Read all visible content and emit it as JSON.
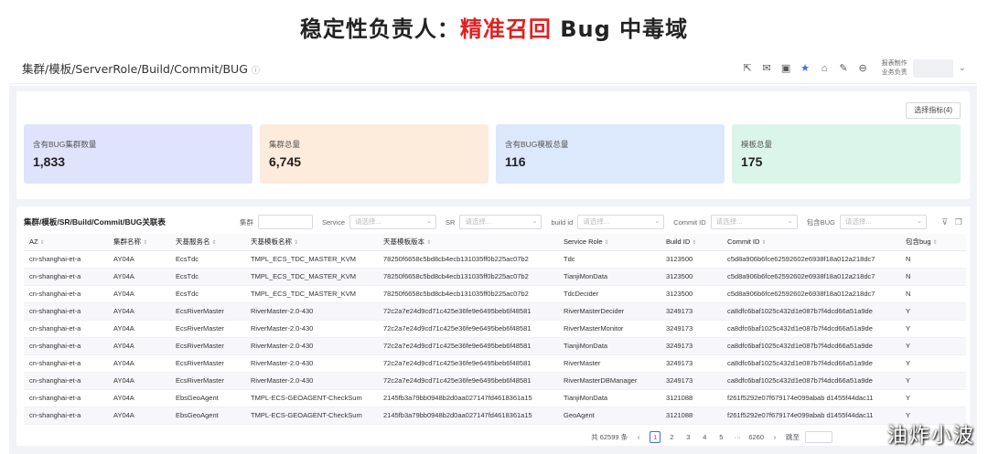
{
  "slide": {
    "title_black_1": "稳定性负责人：",
    "title_red": "精准召回",
    "title_black_2": " Bug 中毒域"
  },
  "header": {
    "breadcrumb": "集群/模板/ServerRole/Build/Commit/BUG",
    "info_icon": "info-icon",
    "icons": [
      "share-icon",
      "mail-icon",
      "image-icon",
      "star-icon",
      "inbox-icon",
      "edit-icon",
      "minus-circle-icon"
    ],
    "owner_line1": "报表制作",
    "owner_line2": "业务负责"
  },
  "stats": {
    "select_button": "选择指标(4)",
    "cards": [
      {
        "label": "含有BUG集群数量",
        "value": "1,833",
        "color": "#dfe3fb"
      },
      {
        "label": "集群总量",
        "value": "6,745",
        "color": "#fdebdc"
      },
      {
        "label": "含有BUG模板总量",
        "value": "116",
        "color": "#dce8fb"
      },
      {
        "label": "模板总量",
        "value": "175",
        "color": "#dcf5ea"
      }
    ]
  },
  "table": {
    "title": "集群/模板/SR/Build/Commit/BUG关联表",
    "filters": [
      {
        "label": "集群",
        "placeholder": ""
      },
      {
        "label": "Service",
        "placeholder": "请选择..."
      },
      {
        "label": "SR",
        "placeholder": "请选择..."
      },
      {
        "label": "build id",
        "placeholder": "请选择..."
      },
      {
        "label": "Commit ID",
        "placeholder": "请选择..."
      },
      {
        "label": "包含BUG",
        "placeholder": "请选择..."
      }
    ],
    "columns": [
      "AZ",
      "集群名称",
      "天基服务名",
      "天基模板名称",
      "天基模板版本",
      "Service Role",
      "Build ID",
      "Commit ID",
      "包含bug"
    ],
    "rows": [
      [
        "cn-shanghai-et-a",
        "AY04A",
        "EcsTdc",
        "TMPL_ECS_TDC_MASTER_KVM",
        "78250f6658c5bd8cb4ecb131035ff0b225ac07b2",
        "Tdc",
        "3123500",
        "c5d8a906b6fce62592602e6938f18a012a218dc7",
        "N"
      ],
      [
        "cn-shanghai-et-a",
        "AY04A",
        "EcsTdc",
        "TMPL_ECS_TDC_MASTER_KVM",
        "78250f6658c5bd8cb4ecb131035ff0b225ac07b2",
        "TianjiMonData",
        "3123500",
        "c5d8a906b6fce62592602e6938f18a012a218dc7",
        "N"
      ],
      [
        "cn-shanghai-et-a",
        "AY04A",
        "EcsTdc",
        "TMPL_ECS_TDC_MASTER_KVM",
        "78250f6658c5bd8cb4ecb131035ff0b225ac07b2",
        "TdcDecider",
        "3123500",
        "c5d8a906b6fce62592602e6938f18a012a218dc7",
        "N"
      ],
      [
        "cn-shanghai-et-a",
        "AY04A",
        "EcsRiverMaster",
        "RiverMaster-2.0-430",
        "72c2a7e24d9cd71c425e36fe9e6495beb6f48581",
        "RiverMasterDecider",
        "3249173",
        "ca8dfc6baf1025c432d1e087b7f4dcd66a51a9de",
        "Y"
      ],
      [
        "cn-shanghai-et-a",
        "AY04A",
        "EcsRiverMaster",
        "RiverMaster-2.0-430",
        "72c2a7e24d9cd71c425e36fe9e6495beb6f48581",
        "RiverMasterMonitor",
        "3249173",
        "ca8dfc6baf1025c432d1e087b7f4dcd66a51a9de",
        "Y"
      ],
      [
        "cn-shanghai-et-a",
        "AY04A",
        "EcsRiverMaster",
        "RiverMaster-2.0-430",
        "72c2a7e24d9cd71c425e36fe9e6495beb6f48581",
        "TianjiMonData",
        "3249173",
        "ca8dfc6baf1025c432d1e087b7f4dcd66a51a9de",
        "Y"
      ],
      [
        "cn-shanghai-et-a",
        "AY04A",
        "EcsRiverMaster",
        "RiverMaster-2.0-430",
        "72c2a7e24d9cd71c425e36fe9e6495beb6f48581",
        "RiverMaster",
        "3249173",
        "ca8dfc6baf1025c432d1e087b7f4dcd66a51a9de",
        "Y"
      ],
      [
        "cn-shanghai-et-a",
        "AY04A",
        "EcsRiverMaster",
        "RiverMaster-2.0-430",
        "72c2a7e24d9cd71c425e36fe9e6495beb6f48581",
        "RiverMasterDBManager",
        "3249173",
        "ca8dfc6baf1025c432d1e087b7f4dcd66a51a9de",
        "Y"
      ],
      [
        "cn-shanghai-et-a",
        "AY04A",
        "EbsGeoAgent",
        "TMPL-ECS-GEOAGENT-CheckSum",
        "2145fb3a79bb0948b2d0aa027147fd4618361a15",
        "TianjiMonData",
        "3121088",
        "f261f5292e07f679174e099abab d1455f44dac11",
        "Y"
      ],
      [
        "cn-shanghai-et-a",
        "AY04A",
        "EbsGeoAgent",
        "TMPL-ECS-GEOAGENT-CheckSum",
        "2145fb3a79bb0948b2d0aa027147fd4618361a15",
        "GeoAgent",
        "3121088",
        "f261f5292e07f679174e099abab d1455f44dac11",
        "Y"
      ]
    ]
  },
  "pager": {
    "total": "共 62599 条",
    "pages": [
      "1",
      "2",
      "3",
      "4",
      "5"
    ],
    "ellipsis": "···",
    "last": "6260",
    "jump_label": "跳至"
  },
  "watermark": "油炸小波"
}
